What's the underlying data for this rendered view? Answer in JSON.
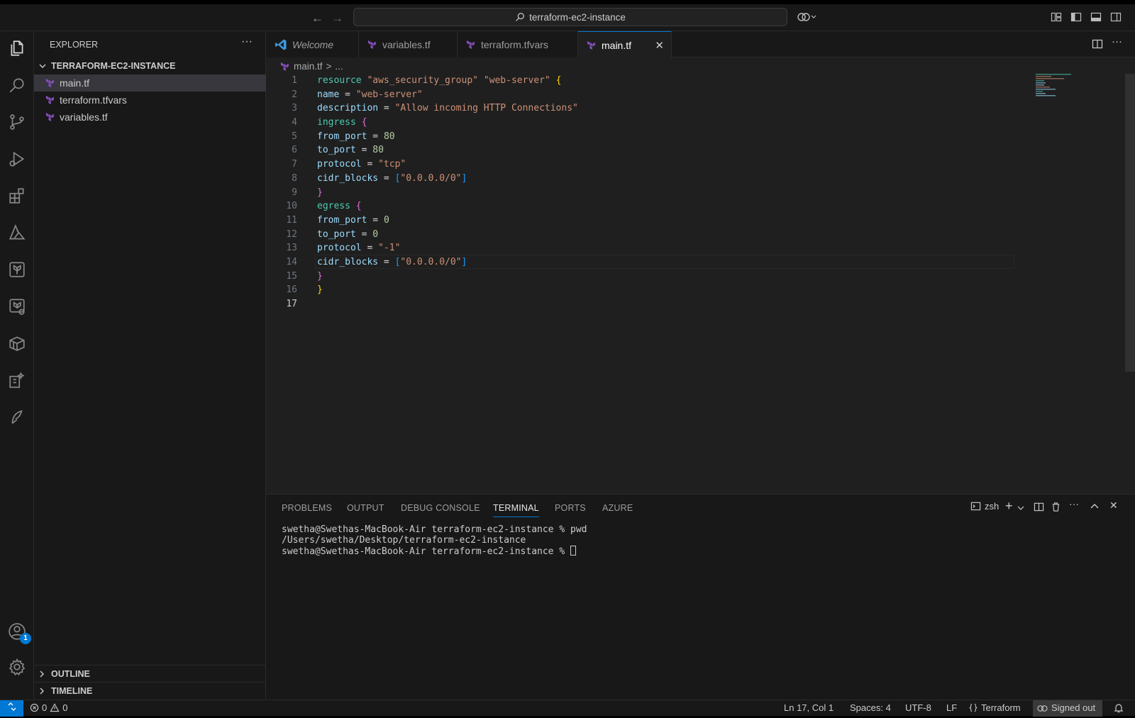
{
  "titlebar": {
    "back_arrow": "←",
    "forward_arrow": "→",
    "search_text": "terraform-ec2-instance",
    "icons": [
      "copilot-icon",
      "layout-customize-icon",
      "toggle-primary-sidebar-icon",
      "toggle-panel-icon",
      "toggle-secondary-sidebar-icon"
    ]
  },
  "activity_bar": {
    "items": [
      "explorer",
      "search",
      "source-control",
      "run-and-debug",
      "extensions",
      "azure",
      "terraform",
      "terraform-cloud",
      "remote-containers",
      "extension-pack",
      "other-extension"
    ],
    "accounts_badge": "1"
  },
  "sidebar": {
    "title": "EXPLORER",
    "more": "···",
    "folder": "TERRAFORM-EC2-INSTANCE",
    "files": [
      "main.tf",
      "terraform.tfvars",
      "variables.tf"
    ],
    "sections": [
      "OUTLINE",
      "TIMELINE"
    ]
  },
  "tabs": [
    {
      "label": "Welcome"
    },
    {
      "label": "variables.tf"
    },
    {
      "label": "terraform.tfvars"
    },
    {
      "label": "main.tf"
    }
  ],
  "breadcrumb": {
    "file": "main.tf",
    "sep": ">",
    "rest": "..."
  },
  "editor": {
    "line_numbers": [
      "1",
      "2",
      "3",
      "4",
      "5",
      "6",
      "7",
      "8",
      "9",
      "10",
      "11",
      "12",
      "13",
      "14",
      "15",
      "16",
      "17"
    ]
  },
  "panel": {
    "tabs": [
      "PROBLEMS",
      "OUTPUT",
      "DEBUG CONSOLE",
      "TERMINAL",
      "PORTS",
      "AZURE"
    ],
    "shell": "zsh",
    "terminal_lines": [
      "swetha@Swethas-MacBook-Air terraform-ec2-instance % pwd",
      "/Users/swetha/Desktop/terraform-ec2-instance",
      "swetha@Swethas-MacBook-Air terraform-ec2-instance % "
    ]
  },
  "statusbar": {
    "errors": "0",
    "warnings": "0",
    "position": "Ln 17, Col 1",
    "spaces": "Spaces: 4",
    "encoding": "UTF-8",
    "eol": "LF",
    "language": "Terraform",
    "account": "Signed out"
  },
  "colors": {
    "accent": "#0078d4",
    "terraform": "#844fba"
  }
}
